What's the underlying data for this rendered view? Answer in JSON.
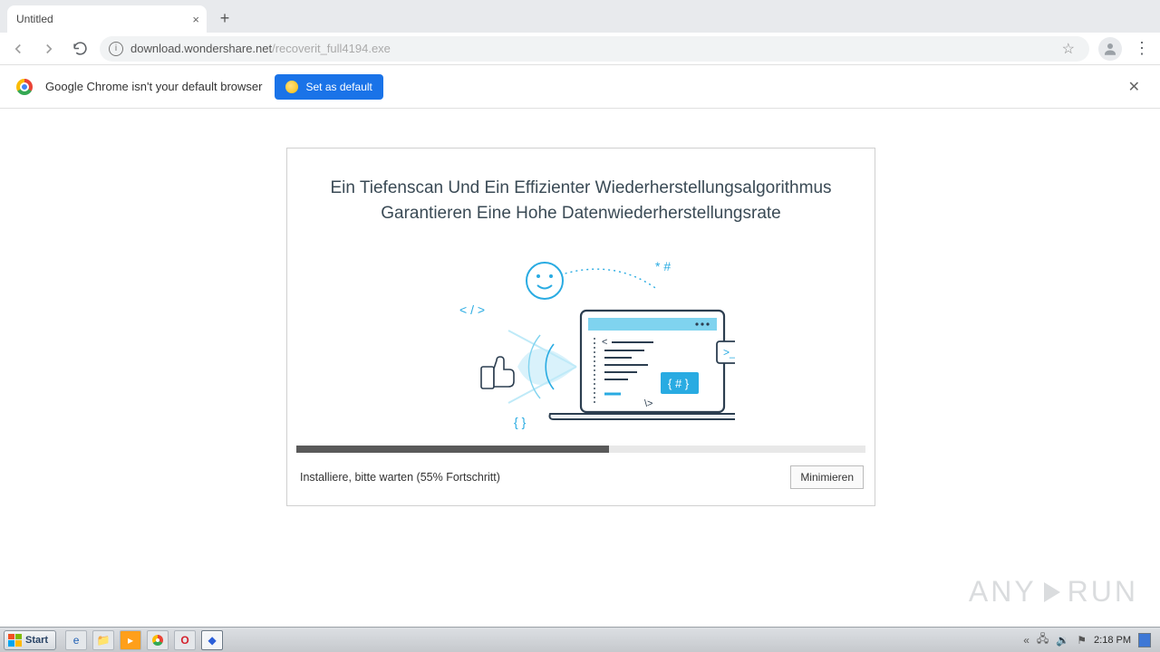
{
  "window_controls": {
    "min": "–",
    "max": "❐",
    "close": "✕"
  },
  "tab": {
    "title": "Untitled"
  },
  "addressbar": {
    "url_black": "download.wondershare.net",
    "url_gray": "/recoverit_full4194.exe"
  },
  "infobar": {
    "message": "Google Chrome isn't your default browser",
    "button": "Set as default"
  },
  "installer": {
    "heading": "Ein Tiefenscan Und Ein Effizienter Wiederherstellungsalgorithmus Garantieren Eine Hohe Datenwiederherstellungsrate",
    "progress_percent": 55,
    "status": "Installiere, bitte warten (55% Fortschritt)",
    "minimize": "Minimieren",
    "decor": {
      "codetag": "< / >",
      "starhash": "* #",
      "braces": "{  }"
    }
  },
  "taskbar": {
    "start": "Start",
    "clock": "2:18 PM"
  },
  "watermark": {
    "left": "ANY",
    "right": "RUN"
  }
}
